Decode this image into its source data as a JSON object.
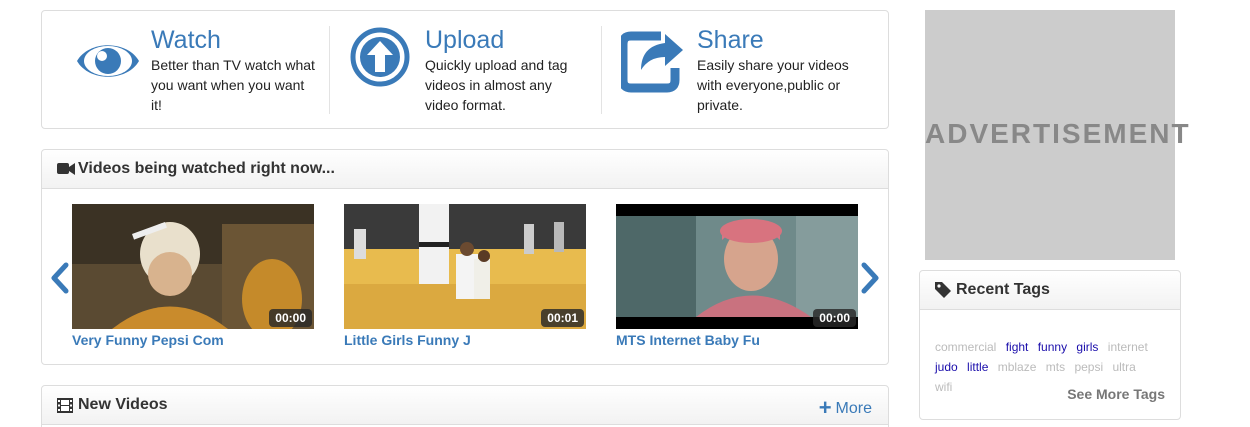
{
  "features": [
    {
      "icon": "eye-icon",
      "title": "Watch",
      "desc": "Better than TV watch what you want when you want it!"
    },
    {
      "icon": "upload-icon",
      "title": "Upload",
      "desc": "Quickly upload and tag videos in almost any video format."
    },
    {
      "icon": "share-icon",
      "title": "Share",
      "desc": "Easily share your videos with everyone,public or private."
    }
  ],
  "watching": {
    "title": "Videos being watched right now...",
    "videos": [
      {
        "title": "Very Funny Pepsi Com",
        "duration": "00:00"
      },
      {
        "title": "Little Girls Funny J",
        "duration": "00:01"
      },
      {
        "title": "MTS Internet Baby Fu",
        "duration": "00:00"
      }
    ]
  },
  "new_videos": {
    "title": "New Videos",
    "more_label": "More"
  },
  "ad": {
    "label": "ADVERTISEMENT"
  },
  "tags": {
    "title": "Recent Tags",
    "items": [
      {
        "label": "commercial",
        "hot": false
      },
      {
        "label": "fight",
        "hot": true
      },
      {
        "label": "funny",
        "hot": true
      },
      {
        "label": "girls",
        "hot": true
      },
      {
        "label": "internet",
        "hot": false
      },
      {
        "label": "judo",
        "hot": true
      },
      {
        "label": "little",
        "hot": true
      },
      {
        "label": "mblaze",
        "hot": false
      },
      {
        "label": "mts",
        "hot": false
      },
      {
        "label": "pepsi",
        "hot": false
      },
      {
        "label": "ultra",
        "hot": false
      },
      {
        "label": "wifi",
        "hot": false
      }
    ],
    "see_more": "See More Tags"
  },
  "colors": {
    "accent": "#3a7ab8",
    "tag_hot": "#1a0dab",
    "tag_cold": "#bbbbbb"
  }
}
